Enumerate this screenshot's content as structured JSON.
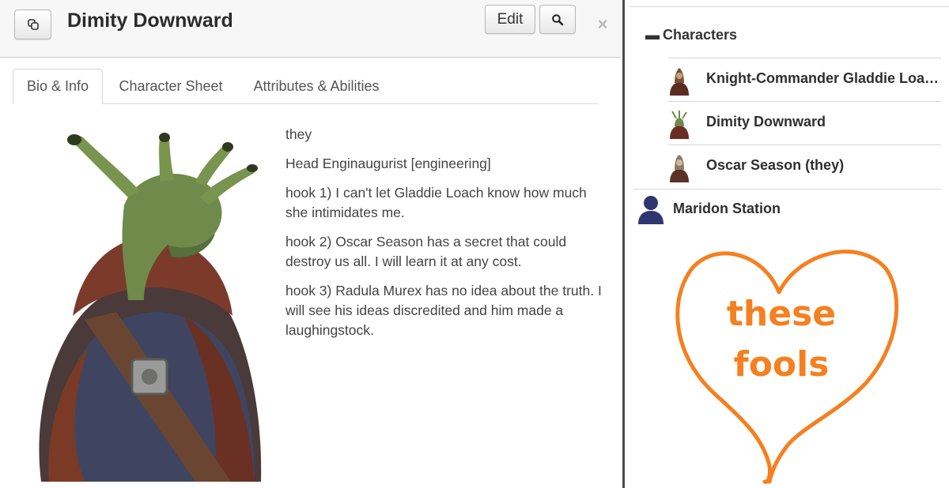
{
  "dialog": {
    "title": "Dimity Downward",
    "edit_label": "Edit",
    "close_label": "×"
  },
  "tabs": [
    {
      "label": "Bio & Info",
      "active": true
    },
    {
      "label": "Character Sheet",
      "active": false
    },
    {
      "label": "Attributes & Abilities",
      "active": false
    }
  ],
  "bio": {
    "lines": [
      "they",
      "Head Enginaugurist [engineering]",
      "hook 1) I can't let Gladdie Loach know how much she intimidates me.",
      "hook 2) Oscar Season has a secret that could destroy us all. I will learn it at any cost.",
      "hook 3) Radula Murex has no idea about the truth. I will see his ideas discredited and him made a laughingstock."
    ]
  },
  "journal": {
    "folder_label": "Characters",
    "characters": [
      {
        "name": "Knight-Commander Gladdie Loac..."
      },
      {
        "name": "Dimity Downward"
      },
      {
        "name": "Oscar Season (they)"
      }
    ],
    "handout": {
      "name": "Maridon Station",
      "icon": "person-icon"
    }
  },
  "doodle": {
    "line1": "these",
    "line2": "fools",
    "color": "#f5801f"
  },
  "icons": {
    "popout": "popout-icon",
    "search": "search-icon",
    "close": "close-icon",
    "collapse": "collapse-icon"
  }
}
